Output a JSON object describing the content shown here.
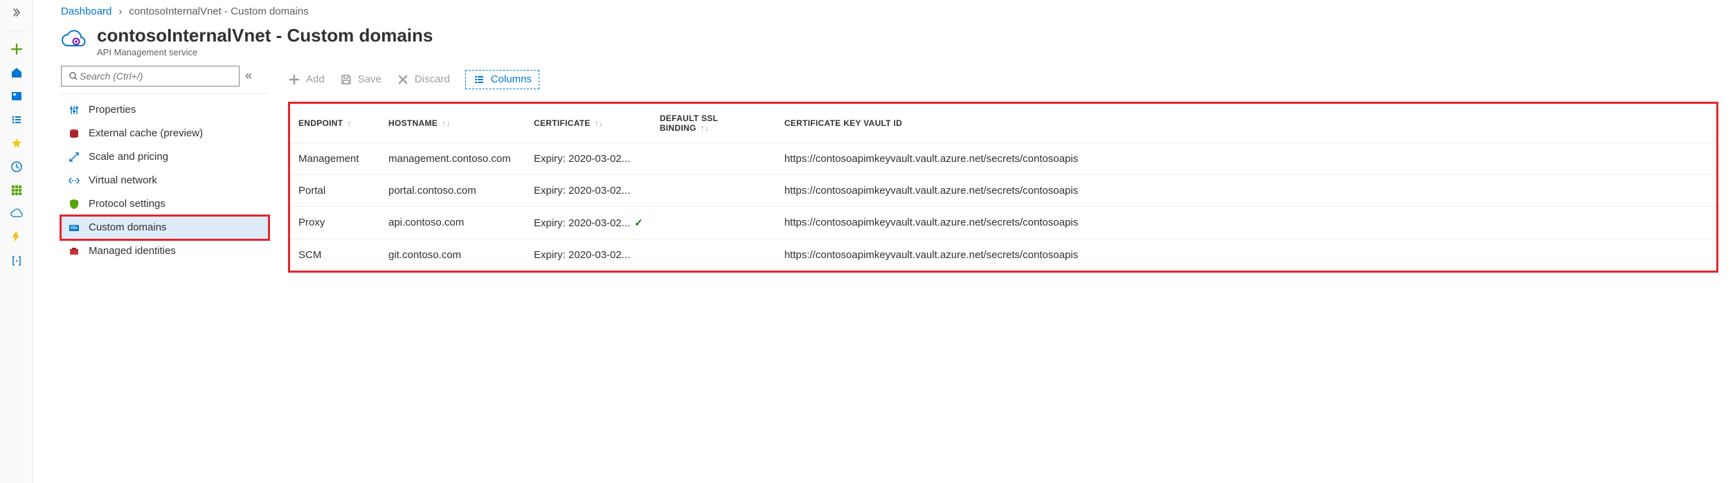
{
  "breadcrumb": {
    "root": "Dashboard",
    "current": "contosoInternalVnet - Custom domains"
  },
  "header": {
    "title": "contosoInternalVnet - Custom domains",
    "subtitle": "API Management service"
  },
  "search": {
    "placeholder": "Search (Ctrl+/)"
  },
  "nav": {
    "properties": "Properties",
    "external_cache": "External cache (preview)",
    "scale": "Scale and pricing",
    "vnet": "Virtual network",
    "protocol": "Protocol settings",
    "custom_domains": "Custom domains",
    "managed_identities": "Managed identities"
  },
  "toolbar": {
    "add": "Add",
    "save": "Save",
    "discard": "Discard",
    "columns": "Columns"
  },
  "table": {
    "headers": {
      "endpoint": "ENDPOINT",
      "hostname": "HOSTNAME",
      "certificate": "CERTIFICATE",
      "default_ssl": "DEFAULT SSL BINDING",
      "keyvault": "CERTIFICATE KEY VAULT ID"
    },
    "rows": [
      {
        "endpoint": "Management",
        "hostname": "management.contoso.com",
        "certificate": "Expiry: 2020-03-02...",
        "default_ssl": "",
        "keyvault": "https://contosoapimkeyvault.vault.azure.net/secrets/contosoapis"
      },
      {
        "endpoint": "Portal",
        "hostname": "portal.contoso.com",
        "certificate": "Expiry: 2020-03-02...",
        "default_ssl": "",
        "keyvault": "https://contosoapimkeyvault.vault.azure.net/secrets/contosoapis"
      },
      {
        "endpoint": "Proxy",
        "hostname": "api.contoso.com",
        "certificate": "Expiry: 2020-03-02...",
        "default_ssl": "check",
        "keyvault": "https://contosoapimkeyvault.vault.azure.net/secrets/contosoapis"
      },
      {
        "endpoint": "SCM",
        "hostname": "git.contoso.com",
        "certificate": "Expiry: 2020-03-02...",
        "default_ssl": "",
        "keyvault": "https://contosoapimkeyvault.vault.azure.net/secrets/contosoapis"
      }
    ]
  }
}
